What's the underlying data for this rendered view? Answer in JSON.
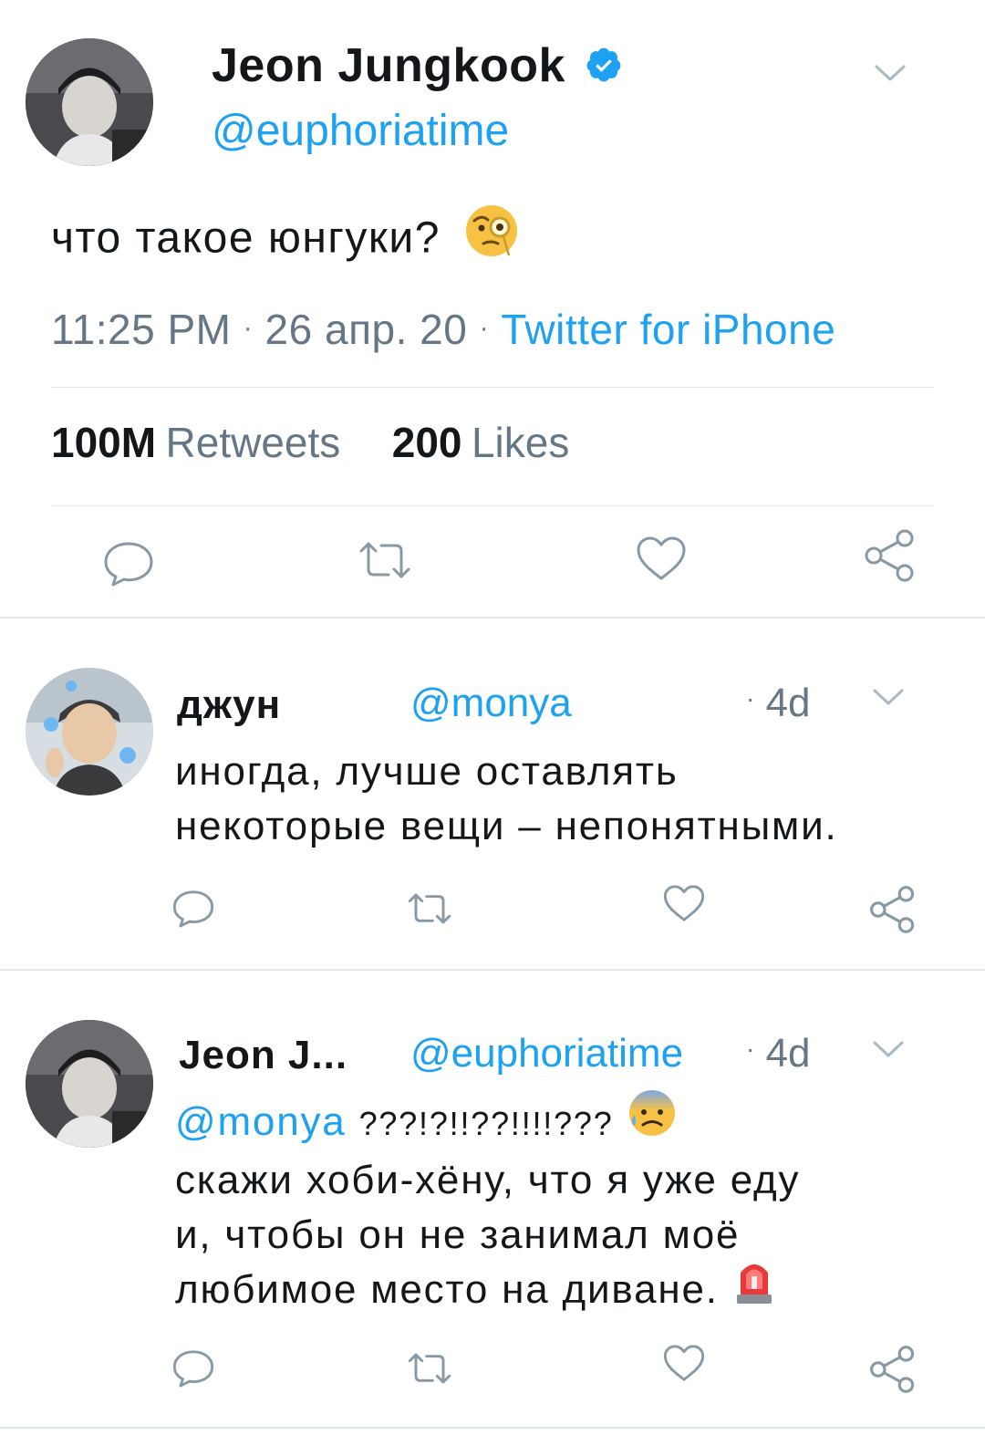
{
  "main_tweet": {
    "display_name": "Jeon Jungkook",
    "handle": "@euphoriatime",
    "text": "что такое юнгуки?",
    "emoji": "face-with-monocle",
    "time": "11:25 PM",
    "date": "26 апр. 20",
    "source": "Twitter for iPhone",
    "dot": "·",
    "retweets_count": "100M",
    "retweets_label": "Retweets",
    "likes_count": "200",
    "likes_label": "Likes"
  },
  "replies": [
    {
      "display_name": "джун",
      "handle": "@monya",
      "time": "4d",
      "dot": "·",
      "lines": [
        "иногда, лучше оставлять",
        "некоторые вещи – непонятными."
      ]
    },
    {
      "display_name": "Jeon J...",
      "handle": "@euphoriatime",
      "time": "4d",
      "dot": "·",
      "mention": "@monya",
      "first_line_rest": "???!?!!??!!!!???",
      "first_line_emoji": "anxious-face-with-sweat",
      "lines": [
        "скажи хоби-хёну, что я уже еду",
        "и, чтобы он не занимал моё",
        "любимое место на диване."
      ],
      "last_line_emoji": "police-light"
    }
  ],
  "colors": {
    "accent": "#1da1f2",
    "text": "#14171a",
    "muted": "#657786",
    "icon": "#8899a6",
    "divider": "#e1e8ed"
  },
  "icons": [
    "reply-icon",
    "retweet-icon",
    "like-icon",
    "share-icon",
    "chevron-down-icon",
    "verified-badge-icon"
  ]
}
